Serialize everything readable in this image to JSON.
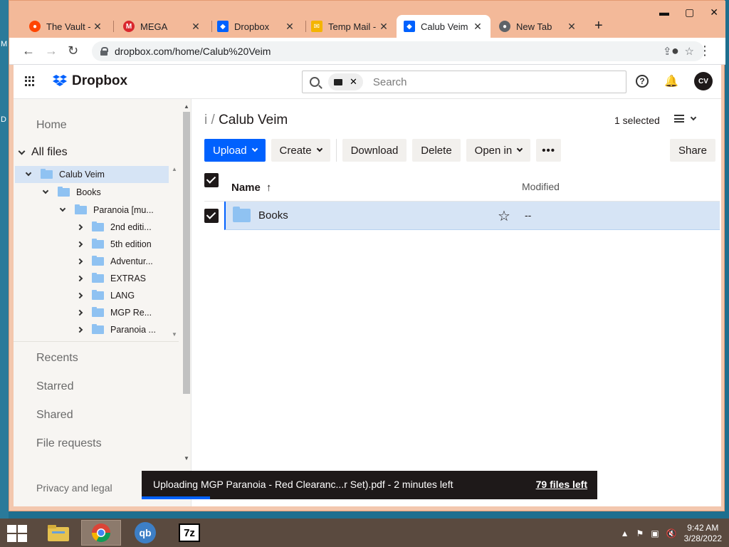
{
  "desktop": {
    "edge_letters": [
      "M",
      "D"
    ]
  },
  "browser": {
    "tabs": [
      {
        "title": "The Vault - t",
        "icon": "reddit-icon",
        "color": "#ff4500",
        "active": false
      },
      {
        "title": "MEGA",
        "icon": "mega-icon",
        "color": "#d9272e",
        "active": false
      },
      {
        "title": "Dropbox",
        "icon": "dropbox-icon",
        "color": "#0061fe",
        "active": false
      },
      {
        "title": "Temp Mail -",
        "icon": "mail-icon",
        "color": "#f4b400",
        "active": false
      },
      {
        "title": "Calub Veim",
        "icon": "dropbox-icon",
        "color": "#0061fe",
        "active": true
      },
      {
        "title": "New Tab",
        "icon": "chrome-icon",
        "color": "#5f6368",
        "active": false
      }
    ],
    "url": "dropbox.com/home/Calub%20Veim"
  },
  "app": {
    "brand": "Dropbox",
    "search_placeholder": "Search",
    "avatar_initials": "CV"
  },
  "sidebar": {
    "home": "Home",
    "all_files": "All files",
    "tree": [
      {
        "label": "Calub Veim",
        "level": 0,
        "expanded": true,
        "selected": true
      },
      {
        "label": "Books",
        "level": 1,
        "expanded": true
      },
      {
        "label": "Paranoia [mu...",
        "level": 2,
        "expanded": true
      },
      {
        "label": "2nd editi...",
        "level": 3,
        "expanded": false
      },
      {
        "label": "5th edition",
        "level": 3,
        "expanded": false
      },
      {
        "label": "Adventur...",
        "level": 3,
        "expanded": false
      },
      {
        "label": "EXTRAS",
        "level": 3,
        "expanded": false
      },
      {
        "label": "LANG",
        "level": 3,
        "expanded": false
      },
      {
        "label": "MGP Re...",
        "level": 3,
        "expanded": false
      },
      {
        "label": "Paranoia ...",
        "level": 3,
        "expanded": false
      }
    ],
    "recents": "Recents",
    "starred": "Starred",
    "shared": "Shared",
    "file_requests": "File requests",
    "privacy": "Privacy and legal"
  },
  "main": {
    "breadcrumb_root": "i",
    "breadcrumb_sep": "/",
    "breadcrumb_current": "Calub Veim",
    "selected_count": "1 selected",
    "toolbar": {
      "upload": "Upload",
      "create": "Create",
      "download": "Download",
      "delete": "Delete",
      "open_in": "Open in",
      "more": "•••",
      "share": "Share"
    },
    "columns": {
      "name": "Name",
      "sort_arrow": "↑",
      "modified": "Modified"
    },
    "rows": [
      {
        "name": "Books",
        "modified": "--",
        "selected": true
      }
    ]
  },
  "upload_toast": {
    "message": "Uploading MGP Paranoia - Red Clearanc...r Set).pdf - 2 minutes left",
    "files_left": "79 files left",
    "progress": 0.15
  },
  "taskbar": {
    "apps": [
      "file-explorer-icon",
      "chrome-icon",
      "qbittorrent-icon",
      "7zip-icon"
    ],
    "qb_label": "qb",
    "zip_label": "7z",
    "time": "9:42 AM",
    "date": "3/28/2022"
  }
}
